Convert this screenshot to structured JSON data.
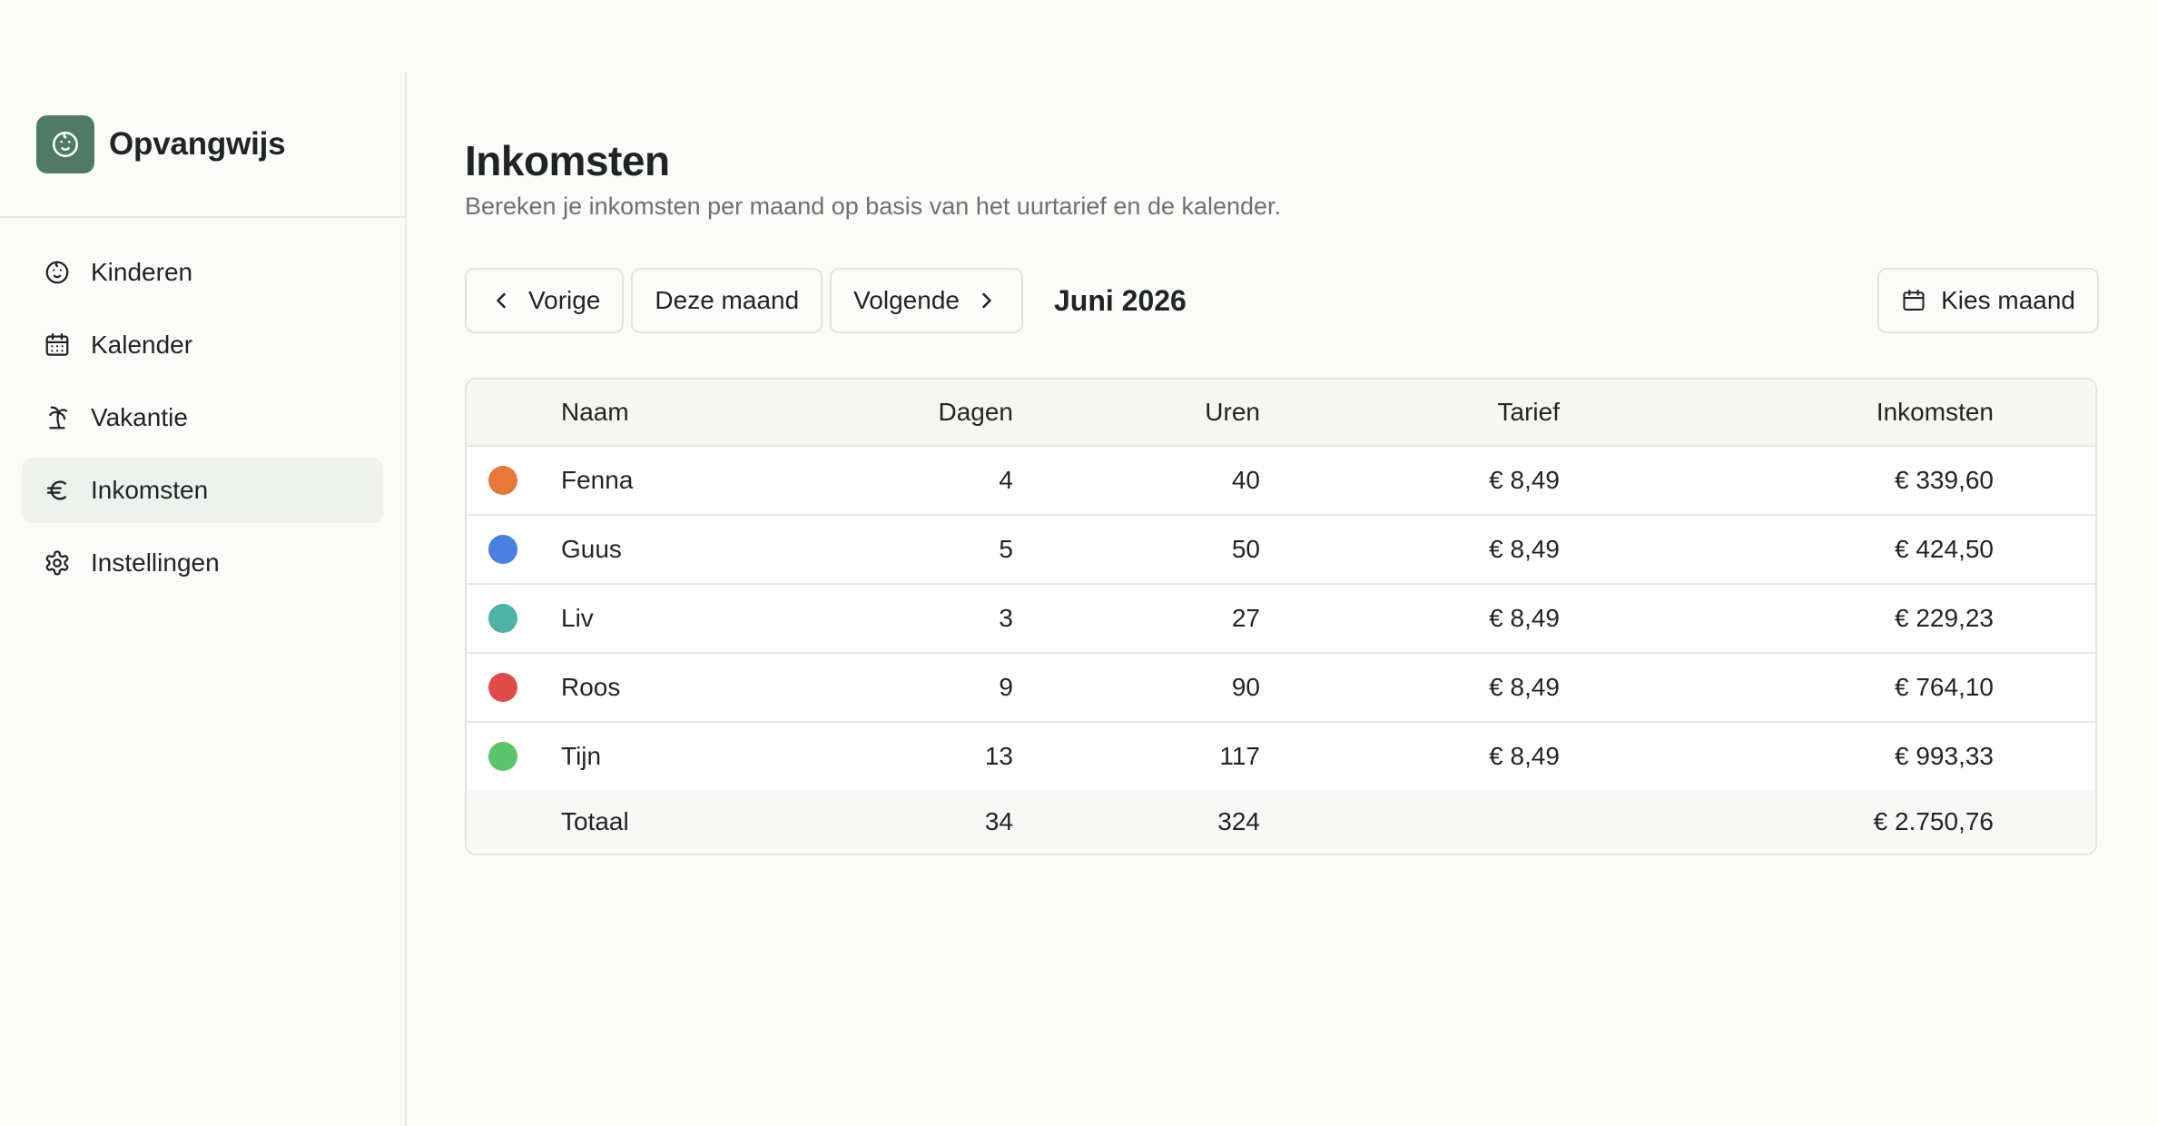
{
  "app": {
    "name": "Opvangwijs"
  },
  "nav": [
    {
      "label": "Kinderen",
      "icon": "baby-icon",
      "active": false
    },
    {
      "label": "Kalender",
      "icon": "calendar-icon",
      "active": false
    },
    {
      "label": "Vakantie",
      "icon": "palm-tree-icon",
      "active": false
    },
    {
      "label": "Inkomsten",
      "icon": "euro-icon",
      "active": true
    },
    {
      "label": "Instellingen",
      "icon": "gear-icon",
      "active": false
    }
  ],
  "page": {
    "title": "Inkomsten",
    "subtitle": "Bereken je inkomsten per maand op basis van het uurtarief en de kalender."
  },
  "toolbar": {
    "prev_label": "Vorige",
    "today_label": "Deze maand",
    "next_label": "Volgende",
    "month": "Juni 2026",
    "pick_label": "Kies maand"
  },
  "table": {
    "headers": {
      "name": "Naam",
      "days": "Dagen",
      "hours": "Uren",
      "rate": "Tarief",
      "income": "Inkomsten"
    },
    "rows": [
      {
        "name": "Fenna",
        "days": "4",
        "hours": "40",
        "rate": "€ 8,49",
        "income": "€ 339,60",
        "color": "#e8783a"
      },
      {
        "name": "Guus",
        "days": "5",
        "hours": "50",
        "rate": "€ 8,49",
        "income": "€ 424,50",
        "color": "#4a7ee0"
      },
      {
        "name": "Liv",
        "days": "3",
        "hours": "27",
        "rate": "€ 8,49",
        "income": "€ 229,23",
        "color": "#4fb3a6"
      },
      {
        "name": "Roos",
        "days": "9",
        "hours": "90",
        "rate": "€ 8,49",
        "income": "€ 764,10",
        "color": "#df4a4a"
      },
      {
        "name": "Tijn",
        "days": "13",
        "hours": "117",
        "rate": "€ 8,49",
        "income": "€ 993,33",
        "color": "#5cc46b"
      }
    ],
    "total": {
      "label": "Totaal",
      "days": "34",
      "hours": "324",
      "income": "€ 2.750,76"
    }
  },
  "colors": {
    "brand": "#4f7a66",
    "active_nav": "#eff1ee"
  }
}
